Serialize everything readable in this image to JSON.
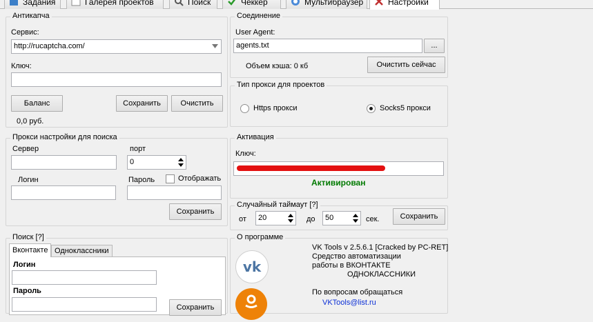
{
  "tabs": [
    {
      "label": "Задания",
      "icon": "tasks-icon"
    },
    {
      "label": "Галерея проектов",
      "icon": "gallery-icon"
    },
    {
      "label": "Поиск",
      "icon": "search-icon"
    },
    {
      "label": "Чеккер",
      "icon": "checker-icon"
    },
    {
      "label": "Мультибраузер",
      "icon": "multibrowser-icon"
    },
    {
      "label": "Настройки",
      "icon": "settings-icon"
    }
  ],
  "anticaptcha": {
    "legend": "Антикапча",
    "service_label": "Сервис:",
    "service_value": "http://rucaptcha.com/",
    "key_label": "Ключ:",
    "key_value": "",
    "balance_button": "Баланс",
    "save_button": "Сохранить",
    "clear_button": "Очистить",
    "balance_value": "0,0 руб."
  },
  "connection": {
    "legend": "Соединение",
    "user_agent_label": "User Agent:",
    "user_agent_value": "agents.txt",
    "browse_button": "...",
    "cache_label": "Объем кэша: 0 кб",
    "clear_now_button": "Очистить сейчас"
  },
  "proxy_type": {
    "legend": "Тип прокси для проектов",
    "options": [
      "Https прокси",
      "Socks5 прокси"
    ],
    "selected": 1
  },
  "search_proxy": {
    "legend": "Прокси настройки для поиска",
    "server_label": "Сервер",
    "port_label": "порт",
    "port_value": "0",
    "login_label": "Логин",
    "password_label": "Пароль",
    "show_label": "Отображать",
    "save_button": "Сохранить"
  },
  "activation": {
    "legend": "Активация",
    "key_label": "Ключ:",
    "status": "Активирован",
    "status_color": "#007a00",
    "redaction_color": "#e31010"
  },
  "timeout": {
    "legend": "Случайный таймаут [?]",
    "from_label": "от",
    "from_value": "20",
    "to_label": "до",
    "to_value": "50",
    "unit_label": "сек.",
    "save_button": "Сохранить"
  },
  "search": {
    "legend": "Поиск [?]",
    "subtabs": [
      "Вконтакте",
      "Одноклассники"
    ],
    "login_label": "Логин",
    "password_label": "Пароль",
    "save_button": "Сохранить"
  },
  "about": {
    "legend": "О программе",
    "version": "VK Tools v 2.5.6.1 [Cracked by PC-RET]",
    "desc_line1": "Средство автоматизации",
    "desc_line2": "работы в ВКОНТАКТЕ",
    "desc_line3": "ОДНОКЛАССНИКИ",
    "contact_label": "По вопросам обращаться",
    "email": "VKTools@list.ru",
    "vk_logo_text": "vk",
    "ok_logo_color": "#ee8208"
  }
}
